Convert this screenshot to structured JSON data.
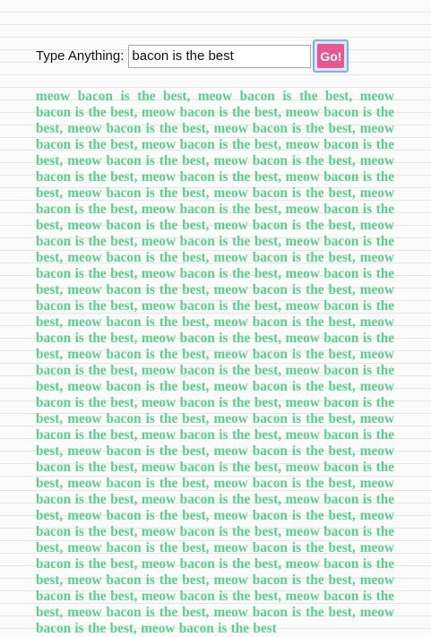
{
  "form": {
    "label": "Type Anything:",
    "input_value": "bacon is the best",
    "button_label": "Go!"
  },
  "output": {
    "text": "meow bacon is the best, meow bacon is the best, meow bacon is the best, meow bacon is the best, meow bacon is the best, meow bacon is the best, meow bacon is the best, meow bacon is the best, meow bacon is the best, meow bacon is the best, meow bacon is the best, meow bacon is the best, meow bacon is the best, meow bacon is the best, meow bacon is the best, meow bacon is the best, meow bacon is the best, meow bacon is the best, meow bacon is the best, meow bacon is the best, meow bacon is the best, meow bacon is the best, meow bacon is the best, meow bacon is the best, meow bacon is the best, meow bacon is the best, meow bacon is the best, meow bacon is the best, meow bacon is the best, meow bacon is the best, meow bacon is the best, meow bacon is the best, meow bacon is the best, meow bacon is the best, meow bacon is the best, meow bacon is the best, meow bacon is the best, meow bacon is the best, meow bacon is the best, meow bacon is the best, meow bacon is the best, meow bacon is the best, meow bacon is the best, meow bacon is the best, meow bacon is the best, meow bacon is the best, meow bacon is the best, meow bacon is the best, meow bacon is the best, meow bacon is the best, meow bacon is the best, meow bacon is the best, meow bacon is the best, meow bacon is the best, meow bacon is the best, meow bacon is the best, meow bacon is the best, meow bacon is the best, meow bacon is the best, meow bacon is the best, meow bacon is the best, meow bacon is the best, meow bacon is the best, meow bacon is the best, meow bacon is the best, meow bacon is the best, meow bacon is the best, meow bacon is the best, meow bacon is the best, meow bacon is the best, meow bacon is the best, meow bacon is the best, meow bacon is the best, meow bacon is the best, meow bacon is the best, meow bacon is the best, meow bacon is the best, meow bacon is the best, meow bacon is the best, meow bacon is the best, meow bacon is the best, meow bacon is the best, meow bacon is the best, meow bacon is the best",
    "color": "#57d08c"
  },
  "colors": {
    "button_bg": "#e8578f",
    "focus_ring": "#7ab3ea",
    "paper_line": "#e6e6e6"
  }
}
